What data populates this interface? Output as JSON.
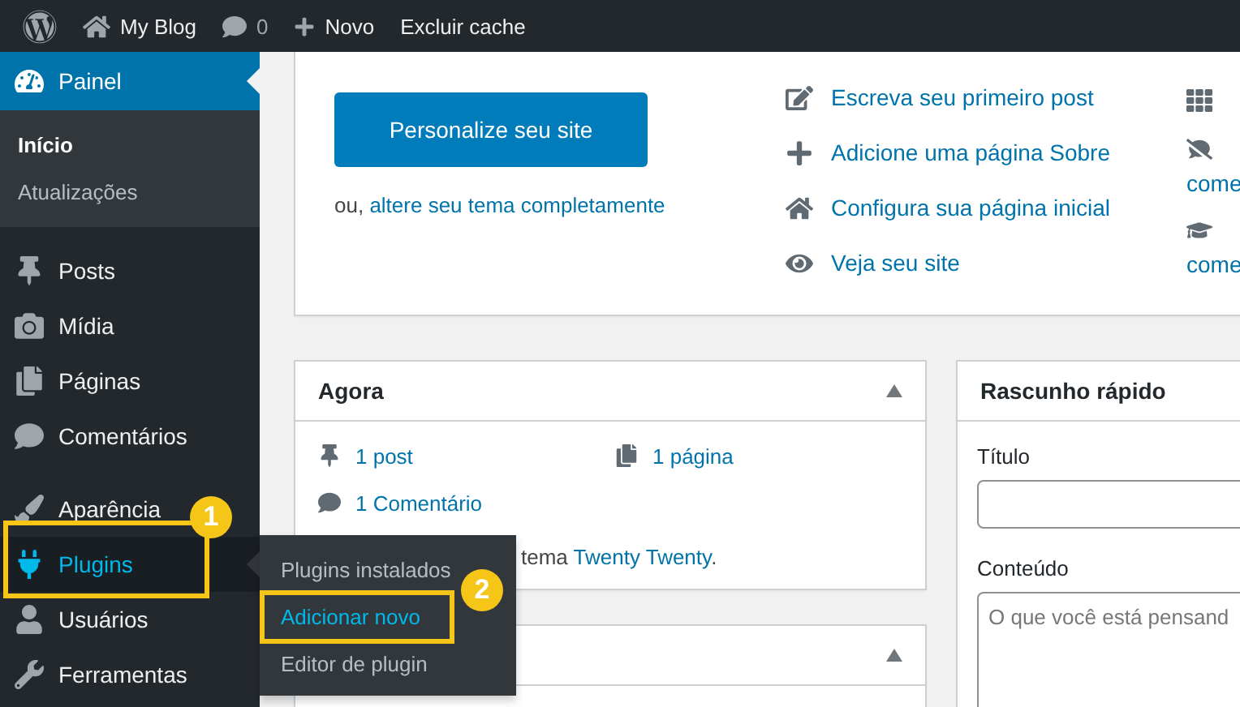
{
  "admin_bar": {
    "site_name": "My Blog",
    "comments_count": "0",
    "new_label": "Novo",
    "cache_label": "Excluir cache"
  },
  "sidebar": {
    "groups": [
      {
        "items": [
          {
            "label": "Painel",
            "kind": "dashboard",
            "selected": true,
            "open": false,
            "children": [
              {
                "label": "Início",
                "selected": true
              },
              {
                "label": "Atualizações",
                "selected": false
              }
            ]
          },
          {
            "label": "Posts",
            "kind": "pin",
            "selected": false,
            "open": false
          },
          {
            "label": "Mídia",
            "kind": "media",
            "selected": false,
            "open": false
          },
          {
            "label": "Páginas",
            "kind": "pages",
            "selected": false,
            "open": false
          },
          {
            "label": "Comentários",
            "kind": "comment",
            "selected": false,
            "open": false
          }
        ]
      },
      {
        "items": [
          {
            "label": "Aparência",
            "kind": "brush",
            "selected": false,
            "open": false
          },
          {
            "label": "Plugins",
            "kind": "plug",
            "selected": false,
            "open": true,
            "callout": "1",
            "flyout": [
              {
                "label": "Plugins instalados",
                "selected": false
              },
              {
                "label": "Adicionar novo",
                "selected": true,
                "callout": "2"
              },
              {
                "label": "Editor de plugin",
                "selected": false
              }
            ]
          },
          {
            "label": "Usuários",
            "kind": "user",
            "selected": false,
            "open": false
          },
          {
            "label": "Ferramentas",
            "kind": "wrench",
            "selected": false,
            "open": false
          }
        ]
      }
    ]
  },
  "welcome": {
    "button": "Personalize seu site",
    "alt_prefix": "ou, ",
    "alt_link": "altere seu tema completamente",
    "next_steps": [
      {
        "kind": "edit",
        "label": "Escreva seu primeiro post"
      },
      {
        "kind": "plus",
        "label": "Adicione uma página Sobre"
      },
      {
        "kind": "home",
        "label": "Configura sua página inicial"
      },
      {
        "kind": "view",
        "label": "Veja seu site"
      }
    ],
    "more_actions": [
      {
        "kind": "widgets"
      },
      {
        "kind": "comments-off",
        "text": "come"
      },
      {
        "kind": "learn",
        "text": "come"
      }
    ]
  },
  "now": {
    "title": "Agora",
    "stats": [
      {
        "kind": "pin",
        "label": "1 post"
      },
      {
        "kind": "pages",
        "label": "1 página"
      },
      {
        "kind": "comment",
        "label": "1 Comentário"
      }
    ],
    "theme_prefix": "tema ",
    "theme_link": "Twenty Twenty",
    "theme_suffix": "."
  },
  "quick_draft": {
    "title": "Rascunho rápido",
    "title_label": "Título",
    "content_label": "Conteúdo",
    "content_placeholder": "O que você está pensand"
  }
}
